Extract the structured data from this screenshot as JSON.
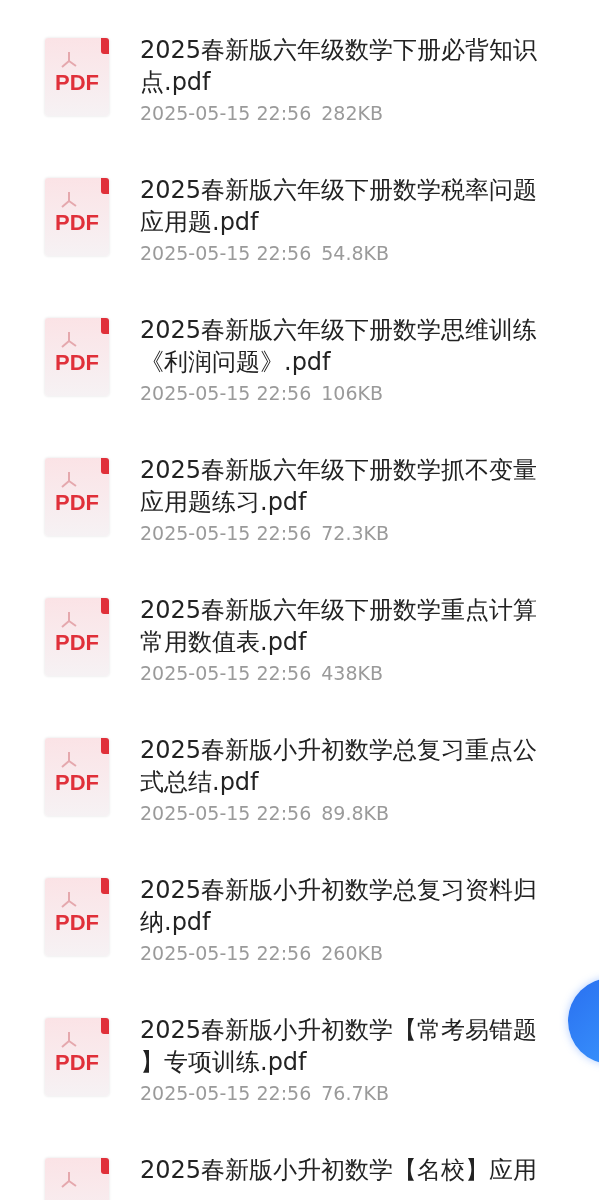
{
  "files": [
    {
      "icon_label": "PDF",
      "title_lines": [
        "2025春新版六年级数学下册必背知识",
        "点.pdf"
      ],
      "date": "2025-05-15 22:56",
      "size": "282KB"
    },
    {
      "icon_label": "PDF",
      "title_lines": [
        "2025春新版六年级下册数学税率问题",
        "应用题.pdf"
      ],
      "date": "2025-05-15 22:56",
      "size": "54.8KB"
    },
    {
      "icon_label": "PDF",
      "title_lines": [
        "2025春新版六年级下册数学思维训练",
        "《利润问题》.pdf"
      ],
      "date": "2025-05-15 22:56",
      "size": "106KB"
    },
    {
      "icon_label": "PDF",
      "title_lines": [
        "2025春新版六年级下册数学抓不变量",
        "应用题练习.pdf"
      ],
      "date": "2025-05-15 22:56",
      "size": "72.3KB"
    },
    {
      "icon_label": "PDF",
      "title_lines": [
        "2025春新版六年级下册数学重点计算",
        "常用数值表.pdf"
      ],
      "date": "2025-05-15 22:56",
      "size": "438KB"
    },
    {
      "icon_label": "PDF",
      "title_lines": [
        "2025春新版小升初数学总复习重点公",
        "式总结.pdf"
      ],
      "date": "2025-05-15 22:56",
      "size": "89.8KB"
    },
    {
      "icon_label": "PDF",
      "title_lines": [
        "2025春新版小升初数学总复习资料归",
        "纳.pdf"
      ],
      "date": "2025-05-15 22:56",
      "size": "260KB"
    },
    {
      "icon_label": "PDF",
      "title_lines": [
        "2025春新版小升初数学【常考易错题",
        "】专项训练.pdf"
      ],
      "date": "2025-05-15 22:56",
      "size": "76.7KB"
    },
    {
      "title_lines": [
        "2025春新版小升初数学【名校】应用"
      ]
    }
  ]
}
